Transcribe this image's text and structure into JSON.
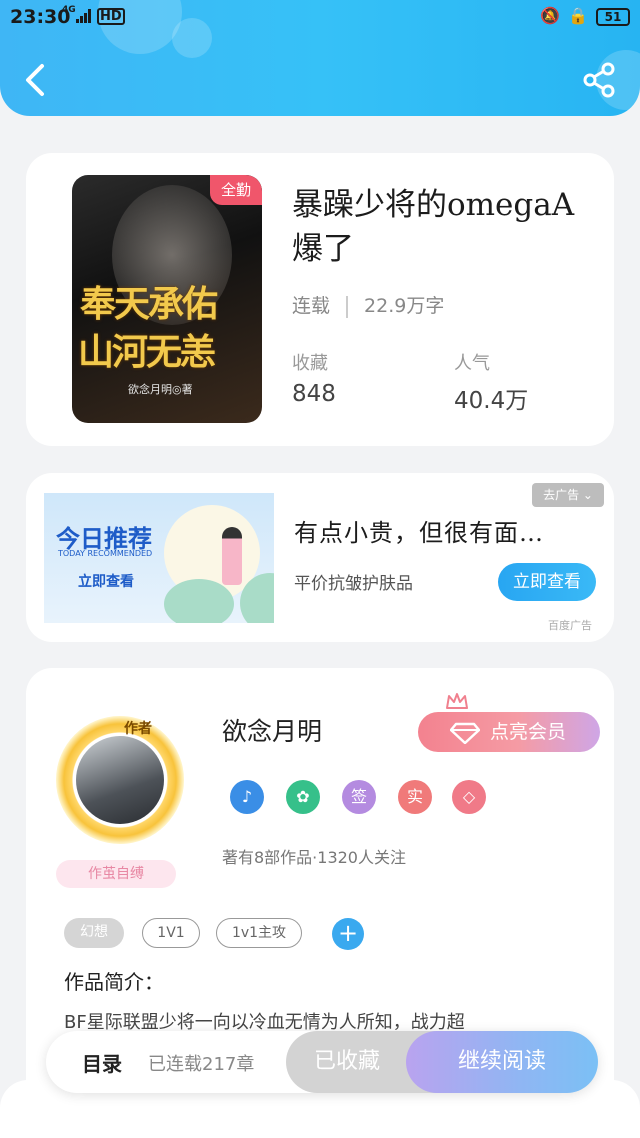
{
  "status_bar": {
    "time": "23:30",
    "network": "4G",
    "hd": "HD",
    "battery": "51"
  },
  "book": {
    "cover_badge": "全勤",
    "cover_title_line1": "奉天承佑",
    "cover_title_line2": "山河无恙",
    "cover_author": "欲念月明◎著",
    "title": "暴躁少将的omegaA爆了",
    "status": "连载",
    "word_count": "22.9万字",
    "stats": [
      {
        "label": "收藏",
        "value": "848"
      },
      {
        "label": "人气",
        "value": "40.4万"
      }
    ]
  },
  "ad": {
    "tag": "去广告 ⌄",
    "image_title": "今日推荐",
    "image_subtitle": "TODAY RECOMMENDED",
    "image_cta": "立即查看",
    "title": "有点小贵，但很有面…",
    "description": "平价抗皱护肤品",
    "button": "立即查看",
    "source": "百度广告"
  },
  "author": {
    "avatar_tag": "作者",
    "sign_label": "作茧自缚",
    "name": "欲念月明",
    "vip_button": "点亮会员",
    "badges": [
      {
        "icon": "music-note-icon",
        "text": "♪",
        "color": "#3a8ee6"
      },
      {
        "icon": "handshake-icon",
        "text": "✿",
        "color": "#36c08a"
      },
      {
        "icon": "sign-badge",
        "text": "签",
        "color": "#b48be0"
      },
      {
        "icon": "real-name-badge",
        "text": "实",
        "color": "#f07a7a"
      },
      {
        "icon": "diamond-icon",
        "text": "◇",
        "color": "#f07a88"
      }
    ],
    "stats": "著有8部作品·1320人关注",
    "tags": [
      "幻想",
      "1V1",
      "1v1主攻"
    ],
    "intro_label": "作品简介：",
    "intro_text": "BF星际联盟少将一向以冷血无情为人所知，战力超"
  },
  "bottom_bar": {
    "toc_label": "目录",
    "toc_count": "已连载217章",
    "collected_button": "已收藏",
    "read_button": "继续阅读"
  }
}
